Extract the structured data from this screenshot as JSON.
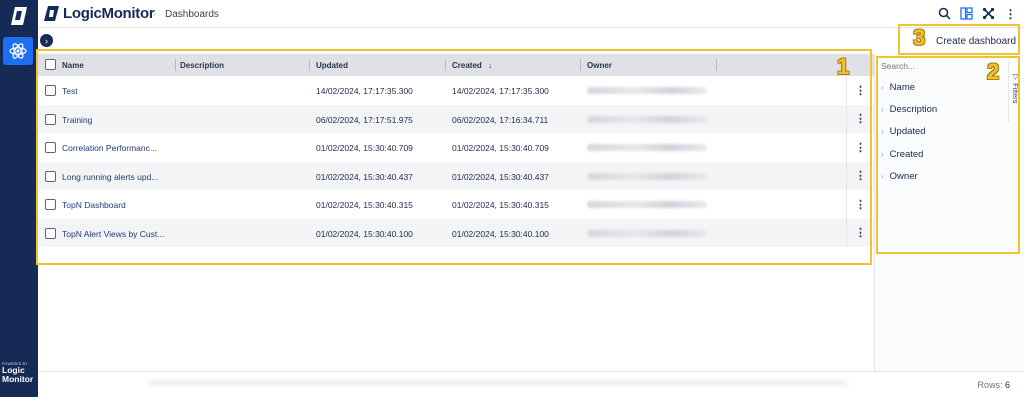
{
  "app": {
    "logo_text": "LogicMonitor",
    "breadcrumb": "Dashboards"
  },
  "nav": {
    "powered_by": "POWERED BY",
    "brand_line1": "Logic",
    "brand_line2": "Monitor"
  },
  "toolbar": {
    "create_label": "Create dashboard"
  },
  "table": {
    "columns": [
      "Name",
      "Description",
      "Updated",
      "Created",
      "Owner"
    ],
    "sort_indicator": "↓",
    "rows": [
      {
        "name": "Test",
        "updated": "14/02/2024, 17:17:35.300",
        "created": "14/02/2024, 17:17:35.300"
      },
      {
        "name": "Training",
        "updated": "06/02/2024, 17:17:51.975",
        "created": "06/02/2024, 17:16:34.711"
      },
      {
        "name": "Correlation Performanc...",
        "updated": "01/02/2024, 15:30:40.709",
        "created": "01/02/2024, 15:30:40.709"
      },
      {
        "name": "Long running alerts upd...",
        "updated": "01/02/2024, 15:30:40.437",
        "created": "01/02/2024, 15:30:40.437"
      },
      {
        "name": "TopN Dashboard",
        "updated": "01/02/2024, 15:30:40.315",
        "created": "01/02/2024, 15:30:40.315"
      },
      {
        "name": "TopN Alert Views by Cust...",
        "updated": "01/02/2024, 15:30:40.100",
        "created": "01/02/2024, 15:30:40.100"
      }
    ]
  },
  "filters": {
    "placeholder": "Search...",
    "tab_label": "Filters",
    "items": [
      "Name",
      "Description",
      "Updated",
      "Created",
      "Owner"
    ]
  },
  "footer": {
    "rows_label": "Rows:",
    "rows_count": "6"
  },
  "annotations": [
    "1",
    "2",
    "3"
  ],
  "colors": {
    "nav": "#152a55",
    "accent": "#1e6ff0",
    "highlight": "#f0c330"
  }
}
